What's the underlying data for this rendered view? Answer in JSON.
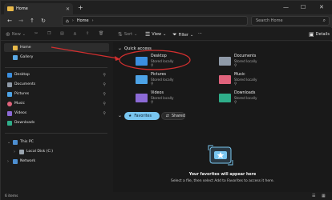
{
  "window": {
    "tab_label": "Home",
    "new_tab": "+",
    "minimize": "—",
    "maximize": "☐",
    "close": "✕"
  },
  "address": {
    "path_label": "Home",
    "search_placeholder": "Search Home"
  },
  "commands": {
    "new_label": "New",
    "sort_label": "Sort",
    "view_label": "View",
    "filter_label": "Filter",
    "details_label": "Details"
  },
  "sidebar": {
    "home": "Home",
    "gallery": "Gallery",
    "pinned": [
      {
        "label": "Desktop",
        "color": "#3b8fe0"
      },
      {
        "label": "Documents",
        "color": "#8f9aa8"
      },
      {
        "label": "Pictures",
        "color": "#4da3e6"
      },
      {
        "label": "Music",
        "color": "#e0637c"
      },
      {
        "label": "Videos",
        "color": "#8c6ad6"
      },
      {
        "label": "Downloads",
        "color": "#2fae8a"
      }
    ],
    "this_pc": "This PC",
    "local_disk": "Local Disk (C:)",
    "network": "Network"
  },
  "main": {
    "quick_access_title": "Quick access",
    "quick_access": [
      {
        "name": "Desktop",
        "sub": "Stored locally",
        "icon": "desktop-folder-icon",
        "color": "#3b8fe0"
      },
      {
        "name": "Documents",
        "sub": "Stored locally",
        "icon": "documents-folder-icon",
        "color": "#8f9aa8"
      },
      {
        "name": "Pictures",
        "sub": "Stored locally",
        "icon": "pictures-folder-icon",
        "color": "#4da3e6"
      },
      {
        "name": "Music",
        "sub": "Stored locally",
        "icon": "music-folder-icon",
        "color": "#e0637c"
      },
      {
        "name": "Videos",
        "sub": "Stored locally",
        "icon": "videos-folder-icon",
        "color": "#8c6ad6"
      },
      {
        "name": "Downloads",
        "sub": "Stored locally",
        "icon": "downloads-folder-icon",
        "color": "#2fae8a"
      }
    ],
    "favorites_label": "Favorites",
    "shared_label": "Shared",
    "empty_title": "Your favorites will appear here",
    "empty_body": "Select a file, then select Add to Favorites to access it here."
  },
  "status": {
    "item_count": "6 items"
  },
  "colors": {
    "accent": "#79c6f0",
    "annotation": "#d32f2f"
  }
}
